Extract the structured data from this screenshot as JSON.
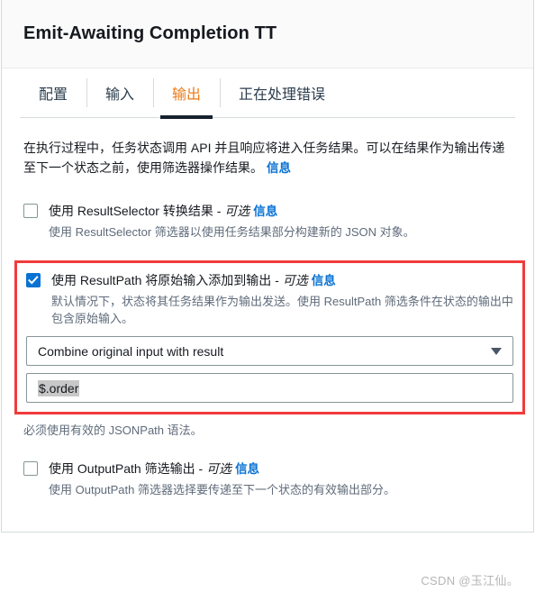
{
  "header": {
    "title": "Emit-Awaiting Completion TT"
  },
  "tabs": [
    {
      "label": "配置",
      "active": false
    },
    {
      "label": "输入",
      "active": false
    },
    {
      "label": "输出",
      "active": true
    },
    {
      "label": "正在处理错误",
      "active": false
    }
  ],
  "intro": {
    "text": "在执行过程中，任务状态调用 API 并且响应将进入任务结果。可以在结果作为输出传递至下一个状态之前，使用筛选器操作结果。",
    "info_label": "信息"
  },
  "result_selector": {
    "checked": false,
    "label": "使用 ResultSelector 转换结果 - ",
    "optional": "可选",
    "info_label": "信息",
    "description": "使用 ResultSelector 筛选器以使用任务结果部分构建新的 JSON 对象。"
  },
  "result_path": {
    "checked": true,
    "label": "使用 ResultPath 将原始输入添加到输出 - ",
    "optional": "可选",
    "info_label": "信息",
    "description": "默认情况下，状态将其任务结果作为输出发送。使用 ResultPath 筛选条件在状态的输出中包含原始输入。",
    "select_value": "Combine original input with result",
    "path_value": "$.order",
    "hint": "必须使用有效的 JSONPath 语法。"
  },
  "output_path": {
    "checked": false,
    "label": "使用 OutputPath 筛选输出 - ",
    "optional": "可选",
    "info_label": "信息",
    "description": "使用 OutputPath 筛选器选择要传递至下一个状态的有效输出部分。"
  },
  "watermark": {
    "text": "CSDN @玉江仙。"
  },
  "colors": {
    "accent_orange": "#eb7a18",
    "link_blue": "#0972d3",
    "checkbox_blue": "#0972d3",
    "highlight_red": "#f23b3b",
    "active_tab_underline": "#16212d"
  }
}
